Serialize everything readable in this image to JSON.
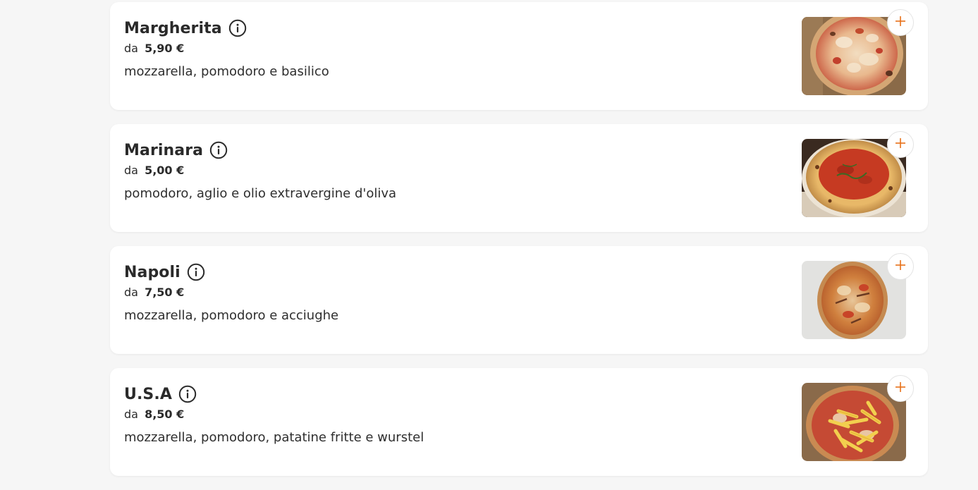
{
  "accent_color": "#e8711a",
  "items": [
    {
      "name": "Margherita",
      "price_prefix": "da",
      "price": "5,90 €",
      "description": "mozzarella, pomodoro e basilico",
      "info_icon": "info-circle-icon",
      "add_icon": "plus-icon"
    },
    {
      "name": "Marinara",
      "price_prefix": "da",
      "price": "5,00 €",
      "description": "pomodoro, aglio e olio extravergine d'oliva",
      "info_icon": "info-circle-icon",
      "add_icon": "plus-icon"
    },
    {
      "name": "Napoli",
      "price_prefix": "da",
      "price": "7,50 €",
      "description": "mozzarella, pomodoro e acciughe",
      "info_icon": "info-circle-icon",
      "add_icon": "plus-icon"
    },
    {
      "name": "U.S.A",
      "price_prefix": "da",
      "price": "8,50 €",
      "description": "mozzarella, pomodoro, patatine fritte e wurstel",
      "info_icon": "info-circle-icon",
      "add_icon": "plus-icon"
    }
  ]
}
